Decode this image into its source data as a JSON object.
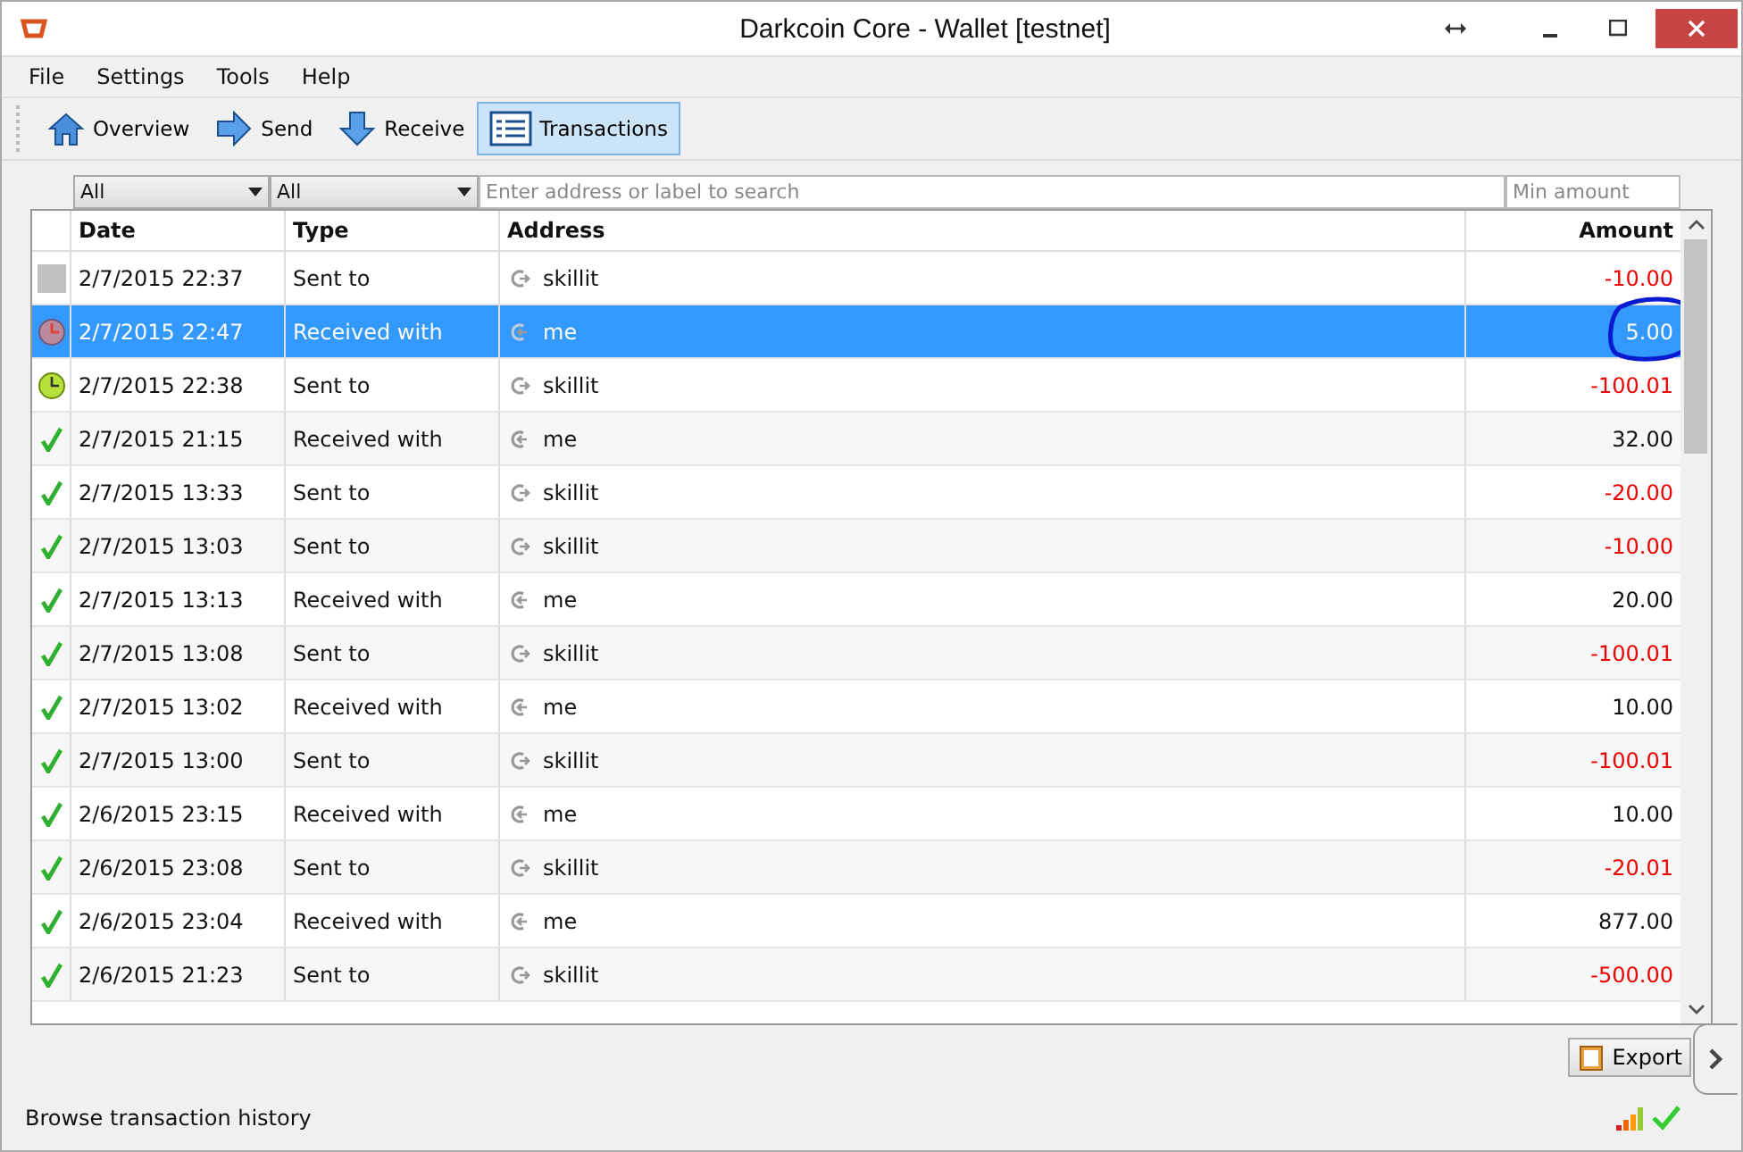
{
  "window": {
    "title": "Darkcoin Core - Wallet [testnet]"
  },
  "menu": [
    "File",
    "Settings",
    "Tools",
    "Help"
  ],
  "toolbar": [
    {
      "label": "Overview",
      "kind": "home",
      "selected": false
    },
    {
      "label": "Send",
      "kind": "send",
      "selected": false
    },
    {
      "label": "Receive",
      "kind": "receive",
      "selected": false
    },
    {
      "label": "Transactions",
      "kind": "list",
      "selected": true
    }
  ],
  "filters": {
    "date": "All",
    "type": "All",
    "search": {
      "placeholder": "Enter address or label to search"
    },
    "min_amount": {
      "placeholder": "Min amount"
    }
  },
  "table": {
    "columns": [
      "Date",
      "Type",
      "Address",
      "Amount"
    ],
    "rows": [
      {
        "kind": "unconfirmed",
        "date": "2/7/2015 22:37",
        "type": "Sent to",
        "outgoing": true,
        "address": "skillit",
        "amount": "-10.00",
        "selected": false
      },
      {
        "kind": "pending",
        "date": "2/7/2015 22:47",
        "type": "Received with",
        "outgoing": false,
        "address": "me",
        "amount": "5.00",
        "selected": true
      },
      {
        "kind": "clock",
        "date": "2/7/2015 22:38",
        "type": "Sent to",
        "outgoing": true,
        "address": "skillit",
        "amount": "-100.01",
        "selected": false
      },
      {
        "kind": "confirmed",
        "date": "2/7/2015 21:15",
        "type": "Received with",
        "outgoing": false,
        "address": "me",
        "amount": "32.00",
        "selected": false
      },
      {
        "kind": "confirmed",
        "date": "2/7/2015 13:33",
        "type": "Sent to",
        "outgoing": true,
        "address": "skillit",
        "amount": "-20.00",
        "selected": false
      },
      {
        "kind": "confirmed",
        "date": "2/7/2015 13:03",
        "type": "Sent to",
        "outgoing": true,
        "address": "skillit",
        "amount": "-10.00",
        "selected": false
      },
      {
        "kind": "confirmed",
        "date": "2/7/2015 13:13",
        "type": "Received with",
        "outgoing": false,
        "address": "me",
        "amount": "20.00",
        "selected": false
      },
      {
        "kind": "confirmed",
        "date": "2/7/2015 13:08",
        "type": "Sent to",
        "outgoing": true,
        "address": "skillit",
        "amount": "-100.01",
        "selected": false
      },
      {
        "kind": "confirmed",
        "date": "2/7/2015 13:02",
        "type": "Received with",
        "outgoing": false,
        "address": "me",
        "amount": "10.00",
        "selected": false
      },
      {
        "kind": "confirmed",
        "date": "2/7/2015 13:00",
        "type": "Sent to",
        "outgoing": true,
        "address": "skillit",
        "amount": "-100.01",
        "selected": false
      },
      {
        "kind": "confirmed",
        "date": "2/6/2015 23:15",
        "type": "Received with",
        "outgoing": false,
        "address": "me",
        "amount": "10.00",
        "selected": false
      },
      {
        "kind": "confirmed",
        "date": "2/6/2015 23:08",
        "type": "Sent to",
        "outgoing": true,
        "address": "skillit",
        "amount": "-20.01",
        "selected": false
      },
      {
        "kind": "confirmed",
        "date": "2/6/2015 23:04",
        "type": "Received with",
        "outgoing": false,
        "address": "me",
        "amount": "877.00",
        "selected": false
      },
      {
        "kind": "confirmed",
        "date": "2/6/2015 21:23",
        "type": "Sent to",
        "outgoing": true,
        "address": "skillit",
        "amount": "-500.00",
        "selected": false
      }
    ]
  },
  "export_button": "Export",
  "status_bar": "Browse transaction history"
}
